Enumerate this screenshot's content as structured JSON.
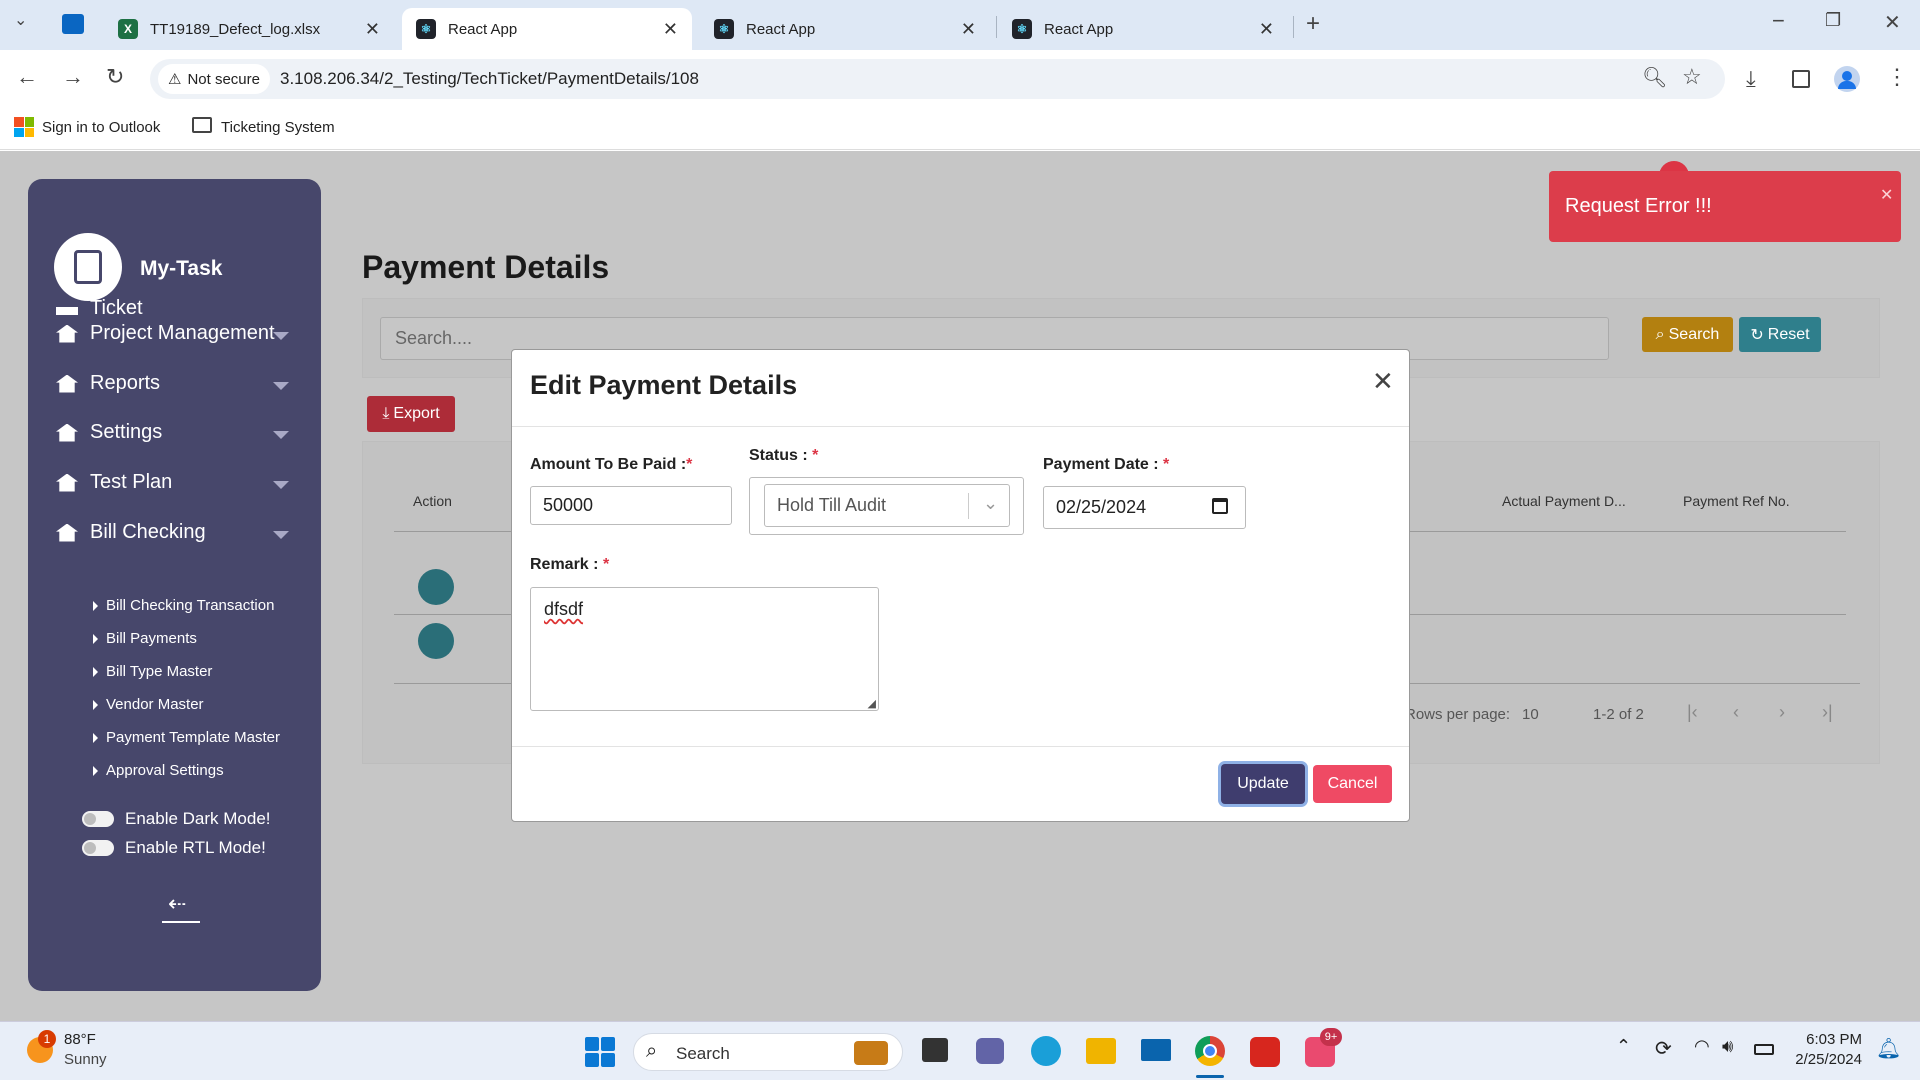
{
  "browser": {
    "tabs": [
      {
        "title": "TT19189_Defect_log.xlsx",
        "active": false
      },
      {
        "title": "React App",
        "active": true
      },
      {
        "title": "React App",
        "active": false
      },
      {
        "title": "React App",
        "active": false
      }
    ],
    "address": {
      "security": "Not secure",
      "url": "3.108.206.34/2_Testing/TechTicket/PaymentDetails/108"
    },
    "bookmarks": [
      "Sign in to Outlook",
      "Ticketing System"
    ]
  },
  "sidebar": {
    "brand": "My-Task",
    "partial_item": "Ticket",
    "items": [
      "Project Management",
      "Reports",
      "Settings",
      "Test Plan",
      "Bill Checking"
    ],
    "subitems": [
      "Bill Checking Transaction",
      "Bill Payments",
      "Bill Type Master",
      "Vendor Master",
      "Payment Template Master",
      "Approval Settings"
    ],
    "toggles": [
      "Enable Dark Mode!",
      "Enable RTL Mode!"
    ]
  },
  "main": {
    "title": "Payment Details",
    "search_placeholder": "Search....",
    "search_label": "Search",
    "reset_label": "Reset",
    "export_label": "Export",
    "table": {
      "col_action": "Action",
      "col_actual_payment": "Actual Payment D...",
      "col_payment_ref": "Payment Ref No."
    },
    "pagination": {
      "rows_label": "Rows per page:",
      "rows_value": "10",
      "range": "1-2 of 2"
    }
  },
  "modal": {
    "title": "Edit Payment Details",
    "amount_label": "Amount To Be Paid :",
    "amount_value": "50000",
    "status_label": "Status :",
    "status_value": "Hold Till Audit",
    "date_label": "Payment Date :",
    "date_value": "02/25/2024",
    "remark_label": "Remark :",
    "remark_value": "dfsdf",
    "required_mark": "*",
    "update_label": "Update",
    "cancel_label": "Cancel"
  },
  "toast": {
    "message": "Request Error !!!"
  },
  "taskbar": {
    "weather_temp": "88°F",
    "weather_desc": "Sunny",
    "weather_badge": "1",
    "search_label": "Search",
    "teams_badge": "9+",
    "time": "6:03 PM",
    "date": "2/25/2024"
  },
  "colors": {
    "sidebar": "#47476b",
    "search_btn": "#e6a000",
    "reset_btn": "#35a3b5",
    "export_btn": "#dc3545",
    "update_btn": "#3f3d6e",
    "cancel_btn": "#ef4a64",
    "toast": "#dc3d4b"
  }
}
